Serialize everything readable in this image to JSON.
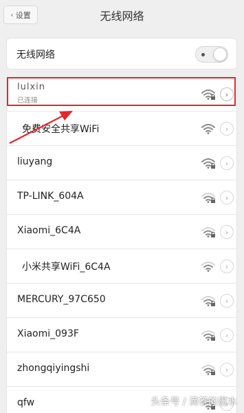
{
  "header": {
    "back_label": "设置",
    "title": "无线网络"
  },
  "wifi_toggle": {
    "label": "无线网络",
    "state": "on"
  },
  "networks": [
    {
      "name": "lulxin",
      "status": "已连接",
      "signal": "strong",
      "locked": true,
      "arrow": "active"
    },
    {
      "name": "免费安全共享WiFi",
      "signal": "strong",
      "locked": false,
      "arrow": "normal"
    },
    {
      "name": "liuyang",
      "signal": "strong",
      "locked": true,
      "arrow": "normal"
    },
    {
      "name": "TP-LINK_604A",
      "signal": "medium",
      "locked": true,
      "arrow": "normal"
    },
    {
      "name": "Xiaomi_6C4A",
      "signal": "medium",
      "locked": true,
      "arrow": "normal"
    },
    {
      "name": "小米共享WiFi_6C4A",
      "signal": "medium",
      "locked": false,
      "arrow": "normal"
    },
    {
      "name": "MERCURY_97C650",
      "signal": "medium",
      "locked": true,
      "arrow": "normal"
    },
    {
      "name": "Xiaomi_093F",
      "signal": "medium",
      "locked": true,
      "arrow": "normal"
    },
    {
      "name": "zhongqiyingshi",
      "signal": "medium",
      "locked": true,
      "arrow": "normal"
    },
    {
      "name": "qfw",
      "signal": "medium",
      "locked": true,
      "arrow": "normal"
    }
  ],
  "watermark": "头条号 / 滴答的墨水",
  "colors": {
    "highlight": "#e4262a",
    "background": "#efeff0"
  }
}
